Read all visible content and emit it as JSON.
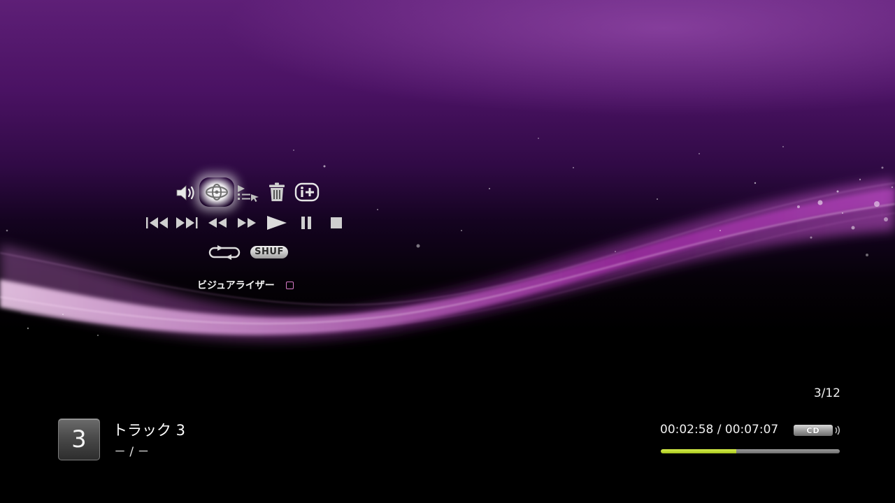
{
  "screen": "music-playback",
  "visualizer": {
    "label": "ビジュアライザー",
    "button_hint_icon": "square-button-icon"
  },
  "controls": {
    "row1": [
      {
        "name": "volume-icon",
        "focused": false
      },
      {
        "name": "display-mode-icon",
        "focused": true
      },
      {
        "name": "playlist-icon",
        "focused": false
      },
      {
        "name": "trash-icon",
        "focused": false
      },
      {
        "name": "info-icon",
        "focused": false
      }
    ],
    "row2": [
      {
        "name": "previous-track-icon"
      },
      {
        "name": "next-track-icon"
      },
      {
        "name": "rewind-icon"
      },
      {
        "name": "fast-forward-icon"
      },
      {
        "name": "play-icon"
      },
      {
        "name": "pause-icon"
      },
      {
        "name": "stop-icon"
      }
    ],
    "row3": {
      "repeat_icon": "repeat-icon",
      "shuffle_label": "SHUF"
    }
  },
  "track": {
    "number": "3",
    "title": "トラック 3",
    "subtitle": "－ / －",
    "counter": "3/12",
    "time_display": "00:02:58 / 00:07:07",
    "elapsed": "00:02:58",
    "duration": "00:07:07",
    "progress_fraction": 0.42,
    "media_badge": "CD"
  },
  "colors": {
    "accent_purple": "#8a2aa0",
    "progress_fill": "#c2dc35",
    "text": "#ffffff"
  }
}
